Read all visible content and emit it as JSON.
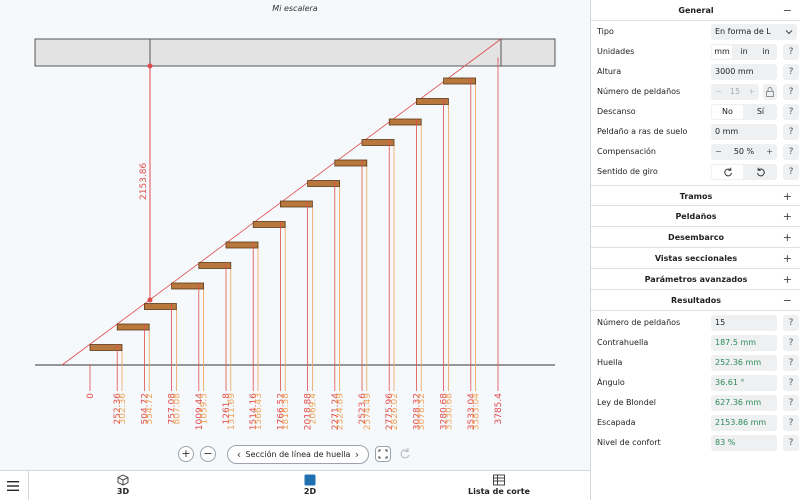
{
  "drawing": {
    "title": "Mi escalera",
    "vertical_dimension": "2153.86",
    "positions_red": [
      "0",
      "252.36",
      "504.72",
      "757.08",
      "1009.44",
      "1261.8",
      "1514.16",
      "1766.52",
      "2018.88",
      "2271.24",
      "2523.6",
      "2775.96",
      "3028.32",
      "3280.68",
      "3533.04",
      "3785.4"
    ],
    "positions_orange": [
      "302.36",
      "554.72",
      "807.08",
      "1059.5",
      "1311.69",
      "1566.43",
      "1816.58",
      "2069.4",
      "2324.89",
      "2574.49",
      "2826.02",
      "3078.32",
      "3330.68",
      "3583.04"
    ],
    "colors": {
      "red": "#e04b4b",
      "orange": "#f0a35a",
      "tread": "#b8773d",
      "slab": "#e3e3e3"
    }
  },
  "controls": {
    "zoom_in": "+",
    "zoom_out": "−",
    "section_label": "Sección de línea de huella",
    "prev": "‹",
    "next": "›"
  },
  "bottom_bar": {
    "tab_3d": "3D",
    "tab_2d": "2D",
    "tab_cut": "Lista de corte"
  },
  "panel": {
    "general": {
      "title": "General",
      "toggle": "−",
      "tipo": {
        "label": "Tipo",
        "value": "En forma de L"
      },
      "unidades": {
        "label": "Unidades",
        "options": [
          "mm",
          "in",
          "in"
        ]
      },
      "altura": {
        "label": "Altura",
        "value": "3000 mm"
      },
      "peldanos": {
        "label": "Número de peldaños",
        "value": "15"
      },
      "descanso": {
        "label": "Descanso",
        "options": [
          "No",
          "Sí"
        ]
      },
      "ras": {
        "label": "Peldaño a ras de suelo",
        "value": "0 mm"
      },
      "compensacion": {
        "label": "Compensación",
        "value": "50 %"
      },
      "sentido": {
        "label": "Sentido de giro"
      }
    },
    "collapsed": [
      {
        "title": "Tramos",
        "toggle": "+"
      },
      {
        "title": "Peldaños",
        "toggle": "+"
      },
      {
        "title": "Desembarco",
        "toggle": "+"
      },
      {
        "title": "Vistas seccionales",
        "toggle": "+"
      },
      {
        "title": "Parámetros avanzados",
        "toggle": "+"
      }
    ],
    "resultados": {
      "title": "Resultados",
      "toggle": "−",
      "rows": [
        {
          "label": "Número de peldaños",
          "value": "15",
          "green": false
        },
        {
          "label": "Contrahuella",
          "value": "187.5 mm",
          "green": true
        },
        {
          "label": "Huella",
          "value": "252.36 mm",
          "green": true
        },
        {
          "label": "Ángulo",
          "value": "36.61 °",
          "green": true
        },
        {
          "label": "Ley de Blondel",
          "value": "627.36 mm",
          "green": true
        },
        {
          "label": "Escapada",
          "value": "2153.86 mm",
          "green": true
        },
        {
          "label": "Nivel de confort",
          "value": "83 %",
          "green": true
        }
      ]
    },
    "help": "?"
  }
}
